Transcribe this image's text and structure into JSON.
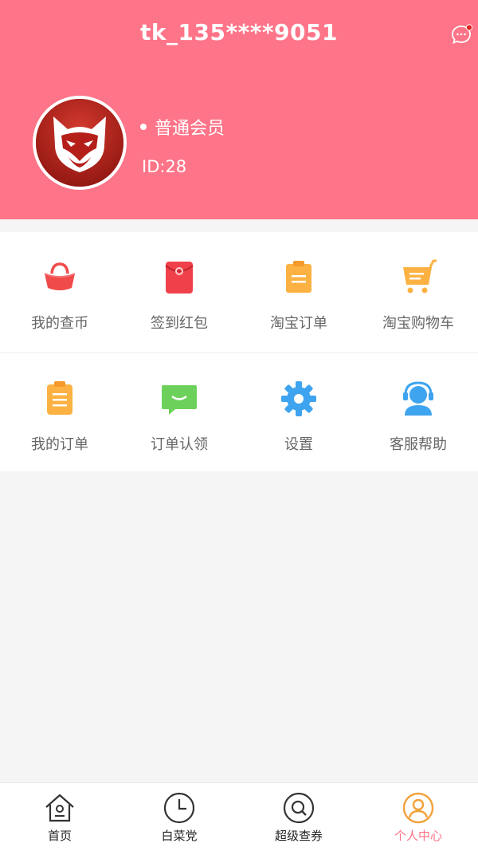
{
  "header": {
    "title": "tk_135****9051",
    "member_level": "普通会员",
    "user_id": "ID:28",
    "background_color": "#fe7488"
  },
  "menu": {
    "row1": [
      {
        "label": "我的查币",
        "icon": "coin-purse-icon"
      },
      {
        "label": "签到红包",
        "icon": "red-envelope-icon"
      },
      {
        "label": "淘宝订单",
        "icon": "taobao-order-icon"
      },
      {
        "label": "淘宝购物车",
        "icon": "shopping-cart-icon"
      }
    ],
    "row2": [
      {
        "label": "我的订单",
        "icon": "clipboard-icon"
      },
      {
        "label": "订单认领",
        "icon": "chat-bubble-icon"
      },
      {
        "label": "设置",
        "icon": "gear-icon"
      },
      {
        "label": "客服帮助",
        "icon": "customer-service-icon"
      }
    ]
  },
  "tabbar": {
    "items": [
      {
        "label": "首页",
        "icon": "home-icon"
      },
      {
        "label": "白菜党",
        "icon": "clock-icon"
      },
      {
        "label": "超级查券",
        "icon": "search-coupon-icon"
      },
      {
        "label": "个人中心",
        "icon": "user-icon",
        "active": true
      }
    ],
    "active_color": "#fe7488"
  }
}
